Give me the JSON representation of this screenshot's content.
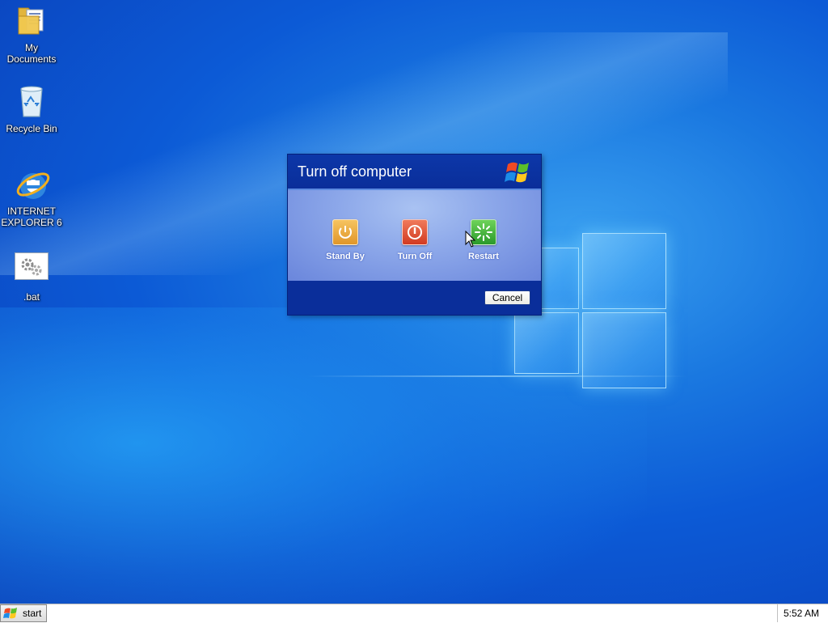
{
  "desktop": {
    "icons": [
      {
        "label": "My\nDocuments",
        "icon": "folder-documents-icon"
      },
      {
        "label": "Recycle Bin",
        "icon": "recycle-bin-icon"
      },
      {
        "label": "INTERNET\nEXPLORER 6",
        "icon": "internet-explorer-icon"
      },
      {
        "label": ".bat",
        "icon": "batch-file-icon"
      }
    ]
  },
  "dialog": {
    "title": "Turn off computer",
    "actions": [
      {
        "label": "Stand By",
        "icon": "standby-power-icon",
        "color": "#e0962a"
      },
      {
        "label": "Turn Off",
        "icon": "turn-off-power-icon",
        "color": "#d23a22"
      },
      {
        "label": "Restart",
        "icon": "restart-icon",
        "color": "#2a9a2a"
      }
    ],
    "cancel_label": "Cancel"
  },
  "taskbar": {
    "start_label": "start",
    "clock": "5:52 AM"
  }
}
